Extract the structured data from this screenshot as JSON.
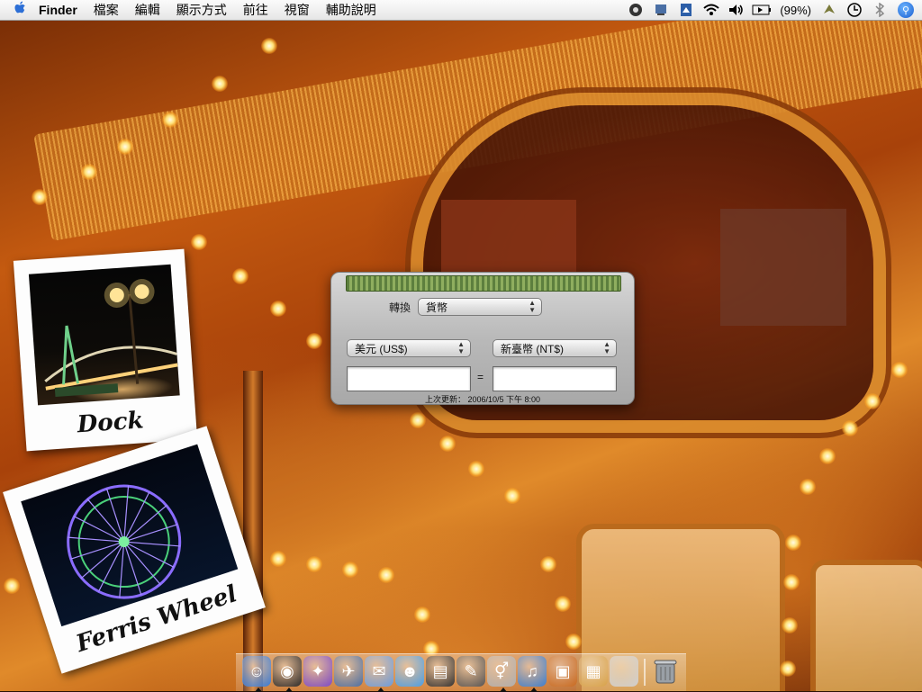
{
  "menubar": {
    "apple_icon": "apple-icon",
    "app_name": "Finder",
    "items": [
      "檔案",
      "編輯",
      "顯示方式",
      "前往",
      "視窗",
      "輔助說明"
    ],
    "status_icons": [
      "unknown-status-icon",
      "sync-icon",
      "display-icon",
      "wifi-icon",
      "volume-icon"
    ],
    "battery_percent": "(99%)",
    "extra_icons": [
      "script-icon",
      "clock-icon",
      "bluetooth-icon"
    ],
    "spotlight_icon": "spotlight-search-icon"
  },
  "polaroids": [
    {
      "caption": "Dock"
    },
    {
      "caption": "Ferris Wheel"
    }
  ],
  "currency_widget": {
    "convert_label": "轉換",
    "convert_type": "貨幣",
    "from_unit": "美元 (US$)",
    "to_unit": "新臺幣 (NT$)",
    "from_value": "",
    "to_value": "",
    "equals": "=",
    "last_updated": "上次更新： 2006/10/5 下午 8:00"
  },
  "dock": {
    "items": [
      {
        "icon": "finder-icon",
        "color": "#3a7bd5",
        "glyph": "☺",
        "running": true
      },
      {
        "icon": "dashboard-icon",
        "color": "#2b2b2b",
        "glyph": "◉",
        "running": true
      },
      {
        "icon": "aqua-ball-icon",
        "color": "#7d4bc8",
        "glyph": "✦",
        "running": false
      },
      {
        "icon": "preview-icon",
        "color": "#4a6fa5",
        "glyph": "✈",
        "running": false
      },
      {
        "icon": "mail-icon",
        "color": "#6a9de0",
        "glyph": "✉",
        "running": true
      },
      {
        "icon": "ichat-icon",
        "color": "#4aa0e8",
        "glyph": "☻",
        "running": false
      },
      {
        "icon": "system-profiler-icon",
        "color": "#333333",
        "glyph": "▤",
        "running": false
      },
      {
        "icon": "script-editor-icon",
        "color": "#555555",
        "glyph": "✎",
        "running": false
      },
      {
        "icon": "gender-app-icon",
        "color": "#b0b0b0",
        "glyph": "⚥",
        "running": true
      },
      {
        "icon": "itunes-icon",
        "color": "#3d7fd0",
        "glyph": "♫",
        "running": true
      },
      {
        "icon": "iphoto-icon",
        "color": "#c96a20",
        "glyph": "▣",
        "running": false
      },
      {
        "icon": "photo-viewer-icon",
        "color": "#d8a24a",
        "glyph": "▦",
        "running": false
      },
      {
        "icon": "apple-folder-icon",
        "color": "#cfcfcf",
        "glyph": "",
        "running": false
      }
    ],
    "trash_icon": "trash-icon"
  }
}
